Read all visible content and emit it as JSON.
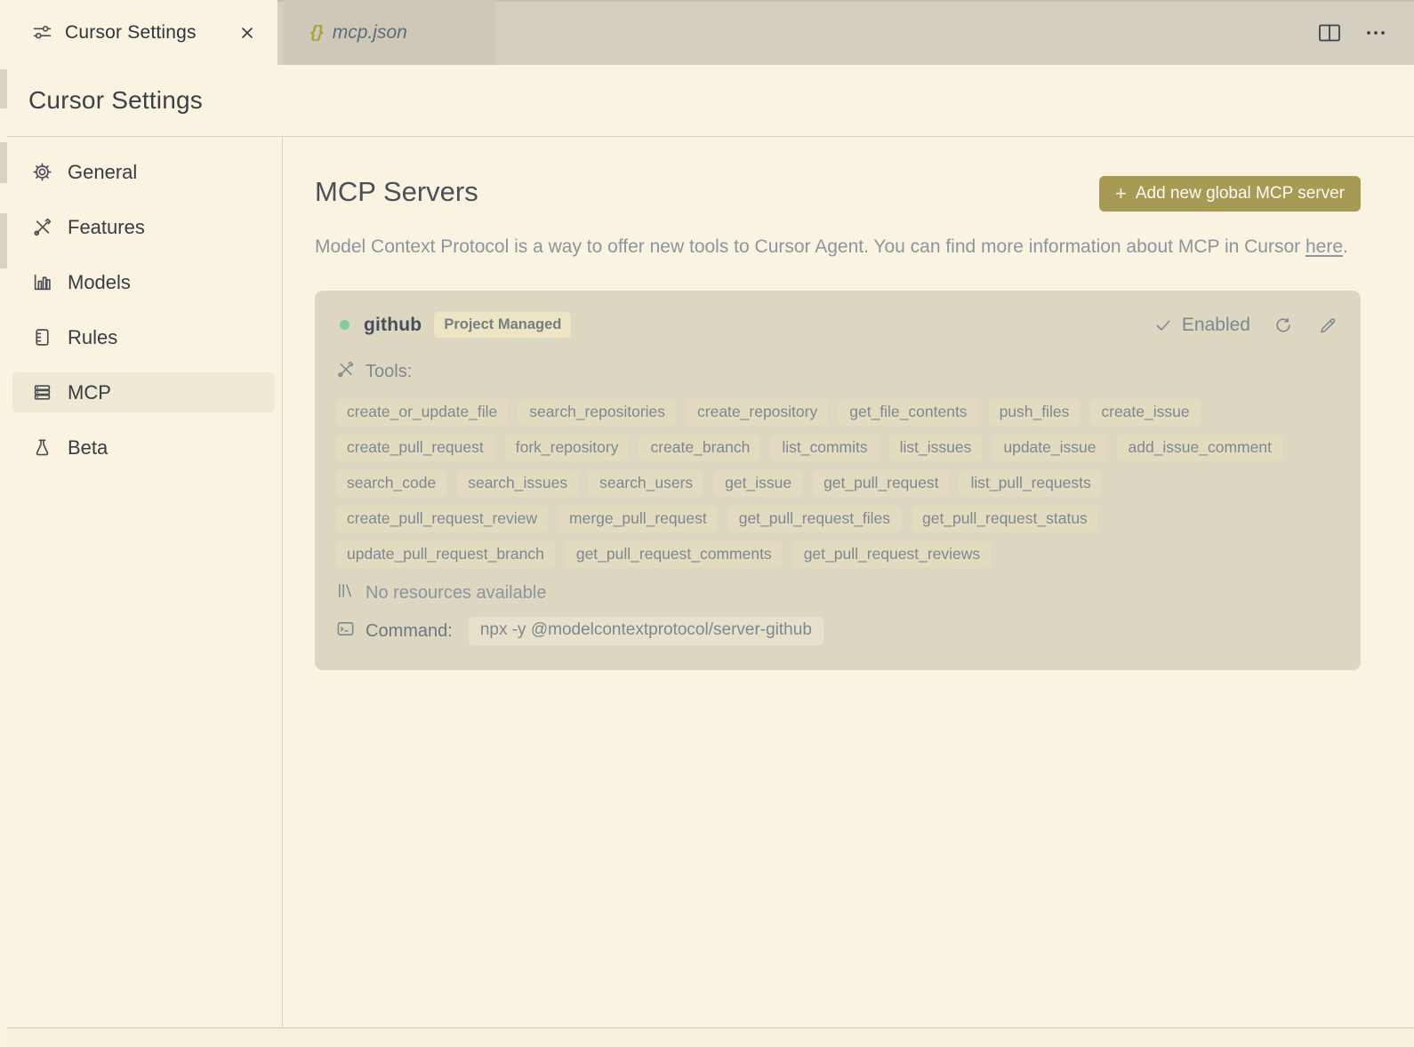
{
  "tabs": {
    "settings": {
      "label": "Cursor Settings"
    },
    "mcp": {
      "label": "mcp.json",
      "icon": "{}"
    }
  },
  "page_title": "Cursor Settings",
  "sidebar": {
    "items": [
      {
        "label": "General"
      },
      {
        "label": "Features"
      },
      {
        "label": "Models"
      },
      {
        "label": "Rules"
      },
      {
        "label": "MCP",
        "selected": true
      },
      {
        "label": "Beta"
      }
    ]
  },
  "main": {
    "title": "MCP Servers",
    "add_button": {
      "plus": "+",
      "label": "Add new global MCP server"
    },
    "description": {
      "text": "Model Context Protocol is a way to offer new tools to Cursor Agent. You can find more information about MCP in Cursor ",
      "link": "here",
      "suffix": "."
    },
    "server": {
      "name": "github",
      "badge": "Project Managed",
      "status": "Enabled",
      "tools_label": "Tools:",
      "tool_rows": [
        [
          "create_or_update_file",
          "search_repositories",
          "create_repository",
          "get_file_contents",
          "push_files",
          "create_issue"
        ],
        [
          "create_pull_request",
          "fork_repository",
          "create_branch",
          "list_commits",
          "list_issues",
          "update_issue",
          "add_issue_comment"
        ],
        [
          "search_code",
          "search_issues",
          "search_users",
          "get_issue",
          "get_pull_request",
          "list_pull_requests"
        ],
        [
          "create_pull_request_review",
          "merge_pull_request",
          "get_pull_request_files",
          "get_pull_request_status"
        ],
        [
          "update_pull_request_branch",
          "get_pull_request_comments",
          "get_pull_request_reviews"
        ]
      ],
      "resources_text": "No resources available",
      "command_label": "Command:",
      "command_value": "npx -y @modelcontextprotocol/server-github"
    }
  },
  "colors": {
    "background": "#faf3e2",
    "tabbar": "#d5cfc1",
    "card": "#ddd6c1",
    "accent_button": "#a69a55",
    "status_green": "#84c9a2"
  }
}
